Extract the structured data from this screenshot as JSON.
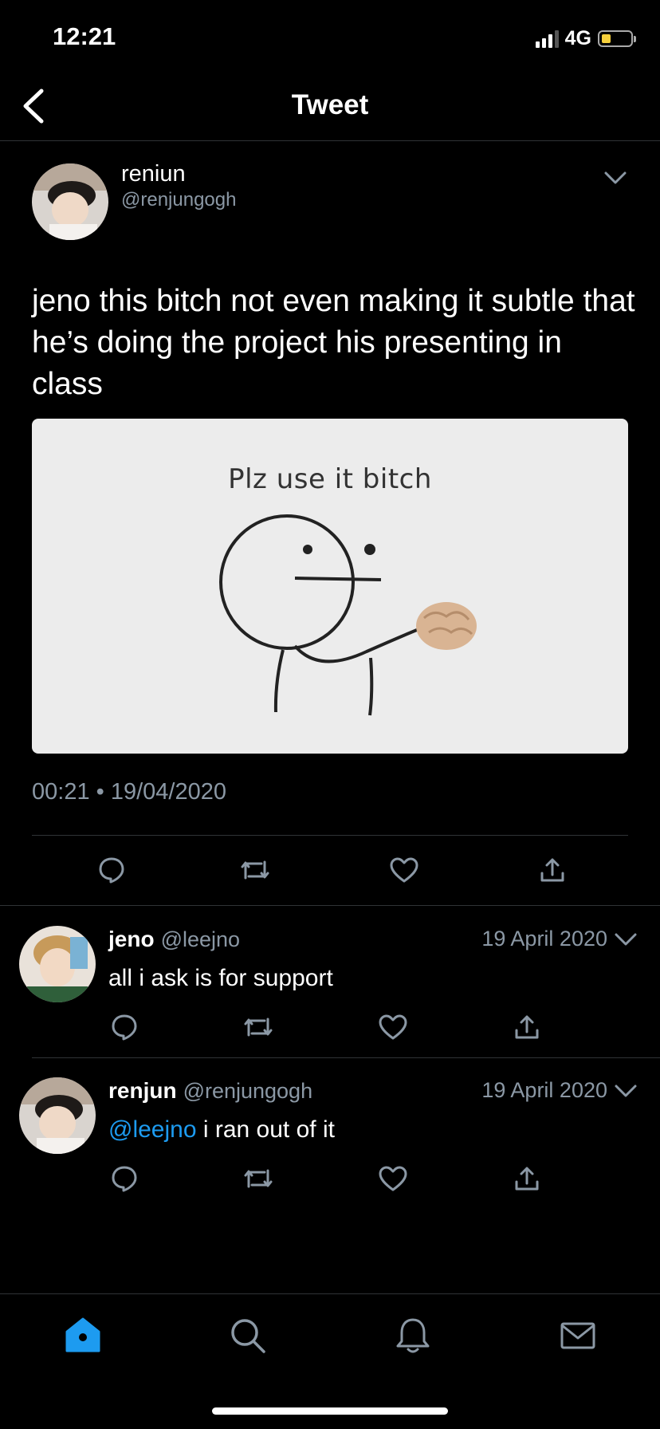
{
  "status": {
    "time": "12:21",
    "network": "4G"
  },
  "nav": {
    "title": "Tweet"
  },
  "tweet": {
    "name": "reniun",
    "handle": "@renjungogh",
    "text": "jeno this bitch not even making it subtle that he’s doing the project his presenting in class",
    "image_caption": "Plz use it bitch",
    "timestamp": "00:21 • 19/04/2020"
  },
  "replies": [
    {
      "name": "jeno",
      "handle": "@leejno",
      "date": "19 April 2020",
      "mention": "",
      "text": "all i ask is for support"
    },
    {
      "name": "renjun",
      "handle": "@renjungogh",
      "date": "19 April 2020",
      "mention": "@leejno",
      "text": " i ran out of it"
    }
  ],
  "colors": {
    "accent": "#1d9bf0",
    "muted": "#8b98a5",
    "background": "#000000",
    "divider": "#2f3336",
    "battery": "#f7d13c"
  },
  "icons": {
    "actions": [
      "reply-icon",
      "retweet-icon",
      "like-icon",
      "share-icon"
    ],
    "tabs": [
      "home-icon",
      "search-icon",
      "notifications-icon",
      "messages-icon"
    ]
  }
}
